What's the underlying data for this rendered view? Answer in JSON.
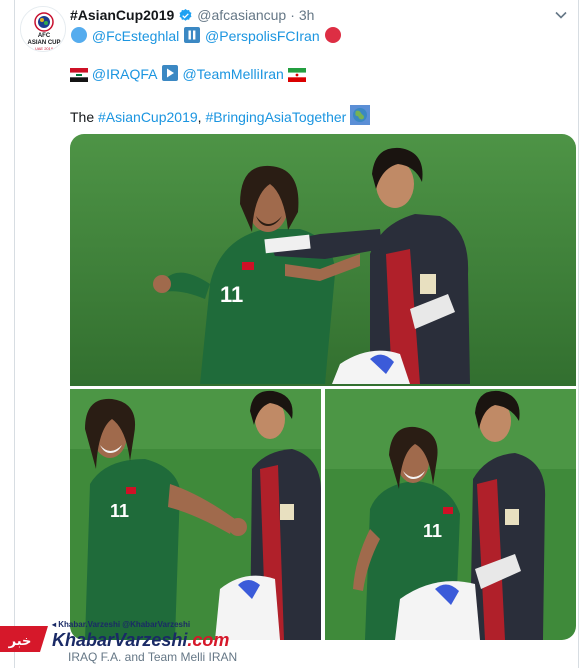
{
  "tweet": {
    "display_name": "#AsianCup2019",
    "handle": "@afcasiancup",
    "separator": "·",
    "time": "3h",
    "line1": {
      "mention_a": "@FcEsteghlal",
      "mention_b": "@PerspolisFCIran"
    },
    "line2": {
      "mention_a": "@IRAQFA",
      "mention_b": "@TeamMelliIran"
    },
    "line3": {
      "prefix": "The ",
      "hashtag_a": "#AsianCup2019",
      "comma": ", ",
      "hashtag_b": "#BringingAsiaTogether"
    },
    "avatar_text": {
      "line1": "AFC",
      "line2": "ASIAN CUP",
      "line3": "UAE 2019"
    }
  },
  "icons": {
    "verified": "verified-badge-icon",
    "chevron": "chevron-down-icon",
    "blue_circle": "blue-circle-emoji",
    "pause": "pause-button-emoji",
    "red_circle": "red-circle-emoji",
    "play": "play-button-emoji",
    "flag_iraq": "iraq-flag-emoji",
    "flag_iran": "iran-flag-emoji",
    "globe": "globe-asia-emoji"
  },
  "player_numbers": {
    "photo1": "11",
    "photo2": "11",
    "photo3": "11"
  },
  "watermark": {
    "top_line": "◂ Khabar.Varzeshi  @KhabarVarzeshi",
    "brand_main": "KhabarVarzeshi",
    "brand_domain": ".com",
    "badge_text": "خبر"
  },
  "caption": "IRAQ F.A. and Team Melli IRAN",
  "colors": {
    "link": "#1b95e0",
    "pitch": "#3f8a3a",
    "iraq_kit": "#1f6b3a",
    "gk_kit": "#2a2e3a",
    "gk_red": "#b0202a",
    "watermark_blue": "#1a2a66",
    "watermark_red": "#d6182a"
  }
}
